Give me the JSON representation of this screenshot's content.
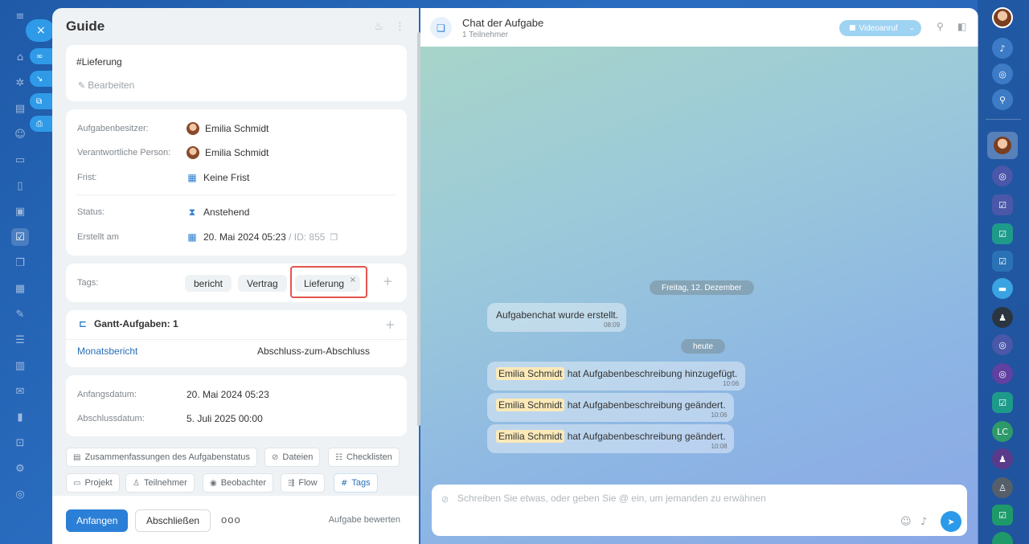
{
  "left_rail": {
    "close_icon": "×",
    "icons": [
      "home-icon",
      "puzzle-icon",
      "feed-icon",
      "people-icon",
      "inbox-icon",
      "document-icon",
      "presentation-icon",
      "tasks-icon",
      "chat-icon",
      "calendar-icon",
      "sign-icon",
      "filter-icon",
      "store-icon",
      "mail-icon",
      "analytics-icon",
      "cart-icon",
      "settings-icon",
      "help-icon"
    ],
    "side_actions": [
      "link-icon",
      "download-icon",
      "open-icon",
      "print-icon"
    ]
  },
  "task": {
    "title": "Guide",
    "description": "#Lieferung",
    "edit_label": "Bearbeiten",
    "owner_label": "Aufgabenbesitzer:",
    "owner_value": "Emilia Schmidt",
    "responsible_label": "Verantwortliche Person:",
    "responsible_value": "Emilia Schmidt",
    "deadline_label": "Frist:",
    "deadline_value": "Keine Frist",
    "status_label": "Status:",
    "status_value": "Anstehend",
    "created_label": "Erstellt am",
    "created_value": "20. Mai 2024 05:23",
    "id_text": "/ ID: 855",
    "tags_label": "Tags:",
    "tags": [
      "bericht",
      "Vertrag",
      "Lieferung"
    ],
    "tag_remove": "×",
    "gantt_title": "Gantt-Aufgaben: 1",
    "gantt_task": "Monatsbericht",
    "gantt_relation": "Abschluss-zum-Abschluss",
    "start_label": "Anfangsdatum:",
    "start_value": "20. Mai 2024 05:23",
    "end_label": "Abschlussdatum:",
    "end_value": "5. Juli 2025 00:00",
    "chips": {
      "summary": "Zusammenfassungen des Aufgabenstatus",
      "files": "Dateien",
      "checklists": "Checklisten",
      "project": "Projekt",
      "participants": "Teilnehmer",
      "observers": "Beobachter",
      "flow": "Flow",
      "tags": "Tags"
    },
    "start_button": "Anfangen",
    "finish_button": "Abschließen",
    "more": "ooo",
    "rate": "Aufgabe bewerten"
  },
  "chat": {
    "title": "Chat der Aufgabe",
    "subtitle": "1 Teilnehmer",
    "video_button": "Videoanruf",
    "date_1": "Freitag, 12. Dezember",
    "date_2": "heute",
    "messages": [
      {
        "text": "Aufgabenchat wurde erstellt.",
        "time": "08:09"
      },
      {
        "name": "Emilia Schmidt",
        "text": "hat Aufgabenbeschreibung hinzugefügt.",
        "time": "10:06"
      },
      {
        "name": "Emilia Schmidt",
        "text": "hat Aufgabenbeschreibung geändert.",
        "time": "10:06"
      },
      {
        "name": "Emilia Schmidt",
        "text": "hat Aufgabenbeschreibung geändert.",
        "time": "10:08"
      }
    ],
    "placeholder": "Schreiben Sie etwas, oder geben Sie @ ein, um jemanden zu erwähnen"
  },
  "right_rail": {
    "lc_initials": "LC"
  },
  "colors": {
    "accent": "#2b7fd6",
    "highlight_border": "#e3554d",
    "name_highlight": "#fbe9b8"
  }
}
